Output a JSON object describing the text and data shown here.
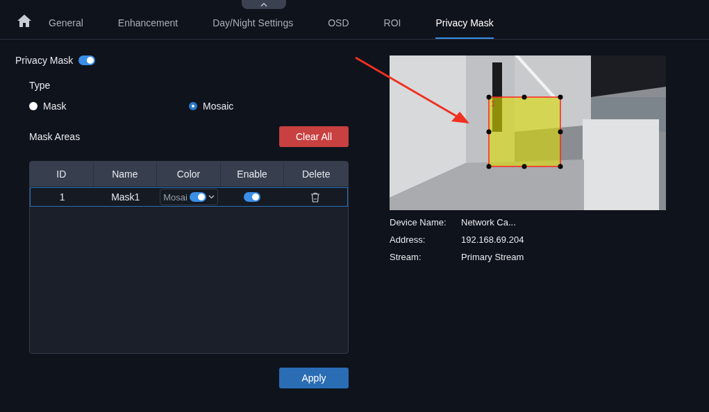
{
  "tabs": [
    {
      "label": "General",
      "selected": false
    },
    {
      "label": "Enhancement",
      "selected": false
    },
    {
      "label": "Day/Night Settings",
      "selected": false
    },
    {
      "label": "OSD",
      "selected": false
    },
    {
      "label": "ROI",
      "selected": false
    },
    {
      "label": "Privacy Mask",
      "selected": true
    }
  ],
  "privacy_mask": {
    "label": "Privacy Mask",
    "on": true
  },
  "type": {
    "label": "Type",
    "options": [
      {
        "label": "Mask",
        "selected": false
      },
      {
        "label": "Mosaic",
        "selected": true
      }
    ]
  },
  "mask_areas": {
    "label": "Mask Areas",
    "clear_button": "Clear All"
  },
  "table": {
    "columns": [
      "ID",
      "Name",
      "Color",
      "Enable",
      "Delete"
    ],
    "rows": [
      {
        "id": "1",
        "name": "Mask1",
        "color_value": "Mosai",
        "color_toggle_on": true,
        "enable": true,
        "selected": true
      }
    ]
  },
  "apply_button": "Apply",
  "preview": {
    "kind": "picture",
    "mask_label": "1"
  },
  "info": [
    {
      "label": "Device Name:",
      "value": "Network Ca..."
    },
    {
      "label": "Address:",
      "value": "192.168.69.204"
    },
    {
      "label": "Stream:",
      "value": "Primary Stream"
    }
  ]
}
